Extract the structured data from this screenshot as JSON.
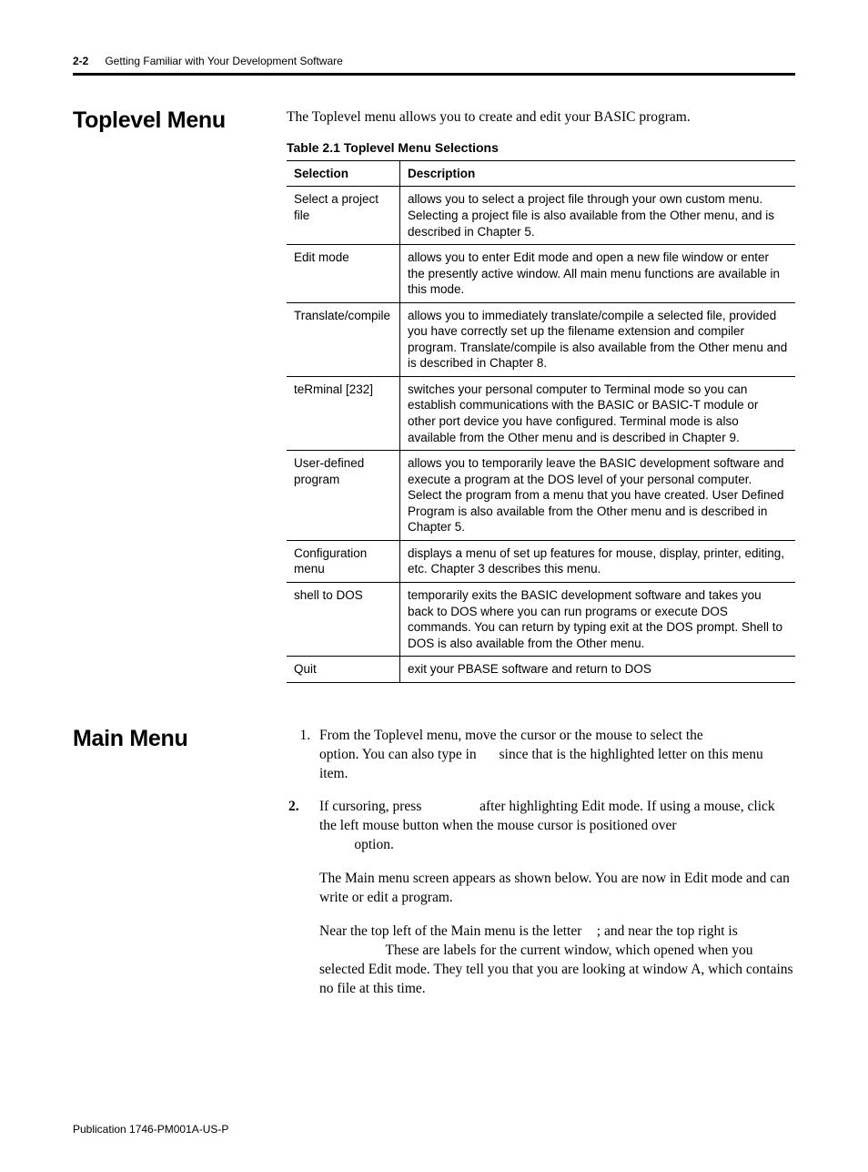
{
  "header": {
    "page_number": "2-2",
    "chapter_title": "Getting Familiar with Your Development Software"
  },
  "section1": {
    "heading": "Toplevel Menu",
    "intro": "The Toplevel menu allows you to create and edit your BASIC program.",
    "table_caption": "Table 2.1 Toplevel Menu Selections",
    "columns": {
      "c1": "Selection",
      "c2": "Description"
    },
    "rows": [
      {
        "sel": "Select a project file",
        "desc": "allows you to select a project file through your own custom menu. Selecting a project file is also available from the Other menu, and is described in Chapter 5."
      },
      {
        "sel": "Edit mode",
        "desc": "allows you to enter Edit mode and open a new file window or enter the presently active window. All main menu functions are available in this mode."
      },
      {
        "sel": "Translate/compile",
        "desc": "allows you to immediately translate/compile a selected file, provided you have correctly set up the filename extension and compiler program. Translate/compile is also available from the Other menu and is described in Chapter 8."
      },
      {
        "sel": "teRminal [232]",
        "desc": "switches your personal computer to Terminal mode so you can establish communications with the BASIC or BASIC-T module or other port device you have configured. Terminal mode is also available from the Other menu and is described in Chapter 9."
      },
      {
        "sel": "User-defined program",
        "desc": "allows you to temporarily leave the BASIC development software and execute a program at the DOS level of your personal computer. Select the program from a menu that you have created. User Defined Program is also available from the Other menu and is described in Chapter 5."
      },
      {
        "sel": "Configuration menu",
        "desc": "displays a menu of set up features for mouse, display, printer, editing, etc. Chapter 3 describes this menu."
      },
      {
        "sel": "shell to DOS",
        "desc": "temporarily exits the BASIC development software and takes you back to DOS where you can run programs or execute DOS commands. You can return by typing exit at the DOS prompt. Shell to DOS is also available from the Other menu."
      },
      {
        "sel": "Quit",
        "desc": "exit your PBASE software and return to DOS"
      }
    ]
  },
  "section2": {
    "heading": "Main Menu",
    "step1_a": "From the Toplevel menu, move the cursor or the mouse to select the ",
    "step1_b": " option. You can also type in ",
    "step1_c": " since that is the highlighted letter on this menu item.",
    "step2_a": "If cursoring, press ",
    "step2_b": " after highlighting Edit mode. If using a mouse, click the left mouse button when the mouse cursor is positioned over ",
    "step2_c": " option.",
    "para1": "The Main menu screen appears as shown below. You are now in Edit mode and can write or edit a program.",
    "para2_a": "Near the top left of the Main menu is the letter ",
    "para2_b": "; and near the top right is ",
    "para2_c": " These are labels for the current window, which opened when you selected Edit mode. They tell you that you are looking at window A, which contains no file at this time."
  },
  "footer": {
    "pub": "Publication 1746-PM001A-US-P"
  }
}
